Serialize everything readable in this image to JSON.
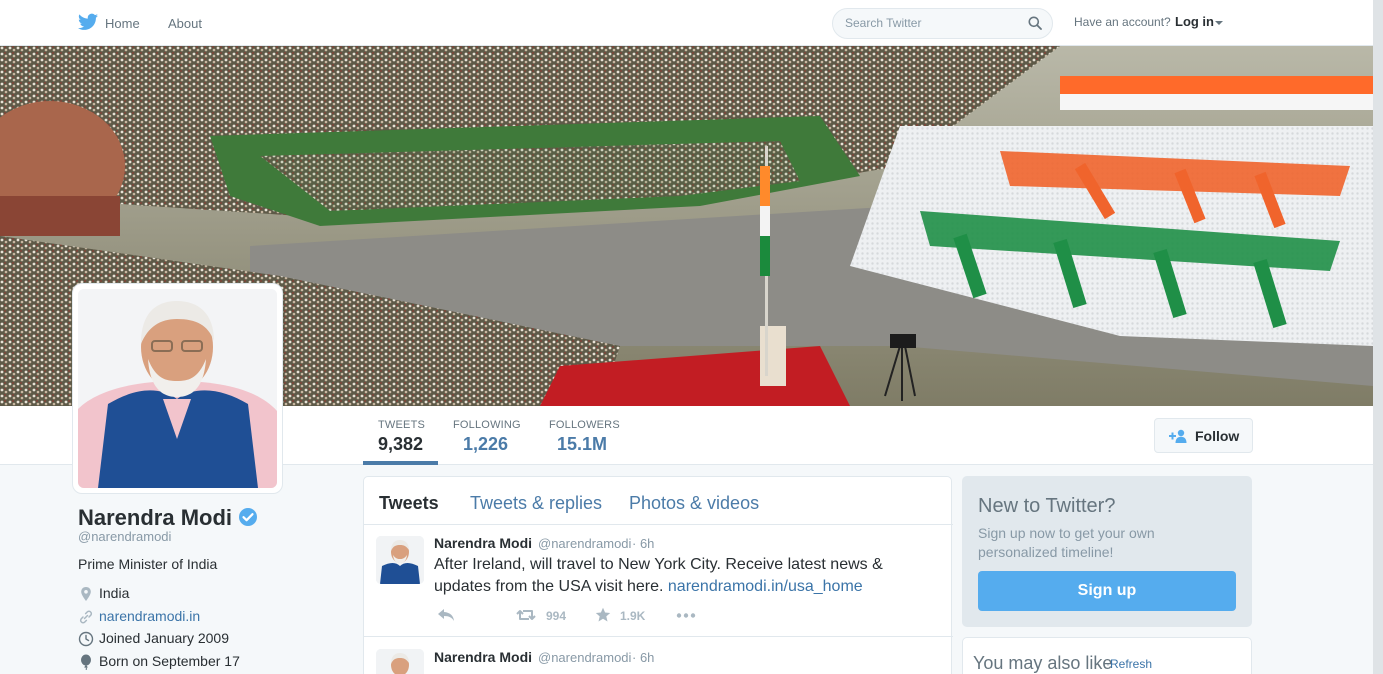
{
  "nav": {
    "home": "Home",
    "about": "About",
    "search_placeholder": "Search Twitter",
    "have_account": "Have an account?",
    "login": "Log in"
  },
  "profile": {
    "name": "Narendra Modi",
    "handle": "@narendramodi",
    "bio": "Prime Minister of India",
    "location": "India",
    "website": "narendramodi.in",
    "joined": "Joined January 2009",
    "born": "Born on September 17"
  },
  "stats": [
    {
      "label": "TWEETS",
      "value": "9,382"
    },
    {
      "label": "FOLLOWING",
      "value": "1,226"
    },
    {
      "label": "FOLLOWERS",
      "value": "15.1M"
    }
  ],
  "follow_label": "Follow",
  "tabs": [
    "Tweets",
    "Tweets & replies",
    "Photos & videos"
  ],
  "tweets": [
    {
      "name": "Narendra Modi",
      "handle": "@narendramodi",
      "time": "· 6h",
      "text": "After Ireland, will travel to New York City. Receive latest news & updates from the USA visit here. ",
      "link": "narendramodi.in/usa_home",
      "retweets": "994",
      "likes": "1.9K"
    },
    {
      "name": "Narendra Modi",
      "handle": "@narendramodi",
      "time": "· 6h"
    }
  ],
  "signup": {
    "heading": "New to Twitter?",
    "text": "Sign up now to get your own personalized timeline!",
    "button": "Sign up"
  },
  "also_like": {
    "heading": "You may also like",
    "separator": "·",
    "refresh": "Refresh"
  },
  "colors": {
    "accent": "#55acee",
    "link": "#3b74a8",
    "stat_underline": "#4b7ba8",
    "verified": "#55acee"
  }
}
